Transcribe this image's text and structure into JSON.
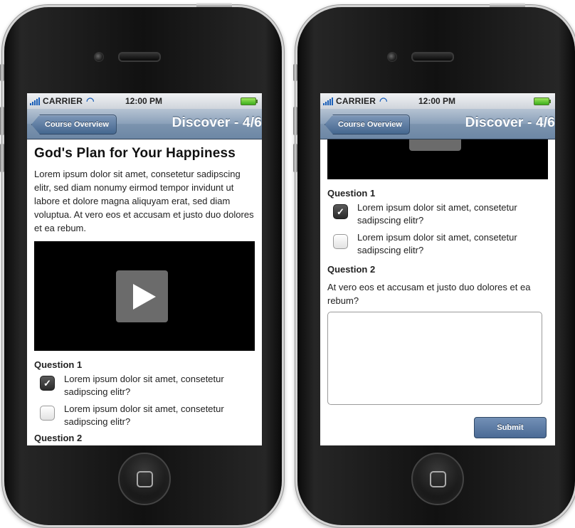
{
  "status_bar": {
    "carrier": "CARRIER",
    "time": "12:00 PM"
  },
  "nav": {
    "back_label": "Course Overview",
    "title": "Discover - 4/6"
  },
  "lesson": {
    "title": "God's Plan for Your Happiness",
    "body": "Lorem ipsum dolor sit amet, consetetur sadipscing elitr, sed diam nonumy eirmod tempor invidunt ut labore et dolore magna aliquyam erat, sed diam voluptua. At vero eos et accusam et justo duo dolores et ea rebum."
  },
  "question1": {
    "label": "Question 1",
    "options": [
      {
        "text": "Lorem ipsum dolor sit amet, consetetur sadipscing elitr?",
        "checked": true
      },
      {
        "text": "Lorem ipsum dolor sit amet, consetetur sadipscing elitr?",
        "checked": false
      }
    ]
  },
  "question2": {
    "label": "Question 2",
    "prompt": "At vero eos et accusam et justo duo dolores et ea rebum?",
    "answer": ""
  },
  "submit_label": "Submit",
  "icons": {
    "check": "checkmark-icon",
    "play": "play-icon",
    "wifi": "wifi-icon",
    "battery": "battery-icon"
  }
}
